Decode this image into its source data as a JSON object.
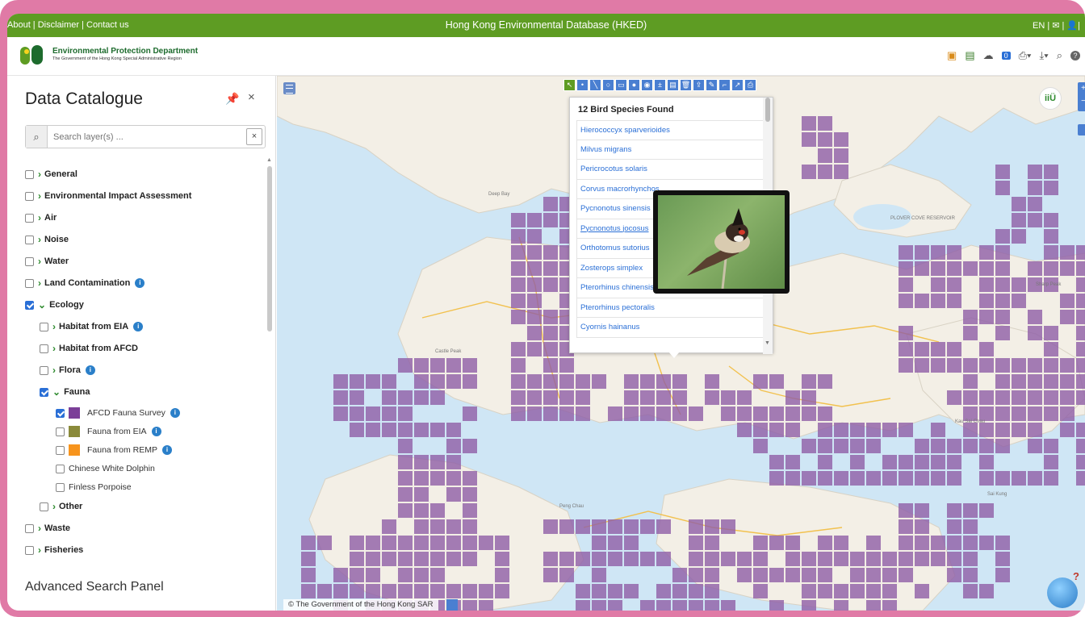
{
  "topbar": {
    "links": "About | Disclaimer | Contact us",
    "title": "Hong Kong Environmental Database (HKED)",
    "lang": "EN | ✉ | 👤|"
  },
  "header": {
    "dept_name": "Environmental Protection Department",
    "dept_sub": "The Government of the Hong Kong Special Administrative Region",
    "layer_count_badge": "0"
  },
  "sidebar": {
    "title": "Data Catalogue",
    "search_placeholder": "Search layer(s) ...",
    "tree": [
      {
        "label": "General",
        "checked": false
      },
      {
        "label": "Environmental Impact Assessment",
        "checked": false
      },
      {
        "label": "Air",
        "checked": false
      },
      {
        "label": "Noise",
        "checked": false
      },
      {
        "label": "Water",
        "checked": false
      },
      {
        "label": "Land Contamination",
        "checked": false
      },
      {
        "label": "Ecology",
        "checked": true
      },
      {
        "label": "Habitat from EIA",
        "checked": false
      },
      {
        "label": "Habitat from AFCD",
        "checked": false
      },
      {
        "label": "Flora",
        "checked": false
      },
      {
        "label": "Fauna",
        "checked": true
      },
      {
        "label": "AFCD Fauna Survey",
        "checked": true,
        "color": "#7b3f98"
      },
      {
        "label": "Fauna from EIA",
        "checked": false,
        "color": "#8a8a3a"
      },
      {
        "label": "Fauna from REMP",
        "checked": false,
        "color": "#f7941d"
      },
      {
        "label": "Chinese White Dolphin",
        "checked": false
      },
      {
        "label": "Finless Porpoise",
        "checked": false
      },
      {
        "label": "Other",
        "checked": false
      },
      {
        "label": "Waste",
        "checked": false
      },
      {
        "label": "Fisheries",
        "checked": false
      }
    ],
    "advanced_title": "Advanced Search Panel"
  },
  "popup": {
    "title": "12 Bird Species Found",
    "species": [
      "Hierococcyx sparverioides",
      "Milvus migrans",
      "Pericrocotus solaris",
      "Corvus macrorhynchos",
      "Pycnonotus sinensis",
      "Pycnonotus jocosus",
      "Orthotomus sutorius",
      "Zosterops simplex",
      "Pterorhinus chinensis",
      "Pterorhinus pectoralis",
      "Cyornis hainanus"
    ],
    "selected": "Pycnonotus jocosus"
  },
  "map": {
    "attribution": "© The Government of the Hong Kong SAR",
    "grid_color": "#8f5ea6",
    "place_labels": [
      "Deep Bay",
      "PLOVER COVE RESERVOIR",
      "Sharp Peak",
      "Castle Peak",
      "Kau Sai Chau",
      "Peng Chau",
      "Sai Kung"
    ]
  },
  "colors": {
    "accent_green": "#5e9c23",
    "link_blue": "#2a6fd6",
    "frame_pink": "#e07aa6"
  }
}
